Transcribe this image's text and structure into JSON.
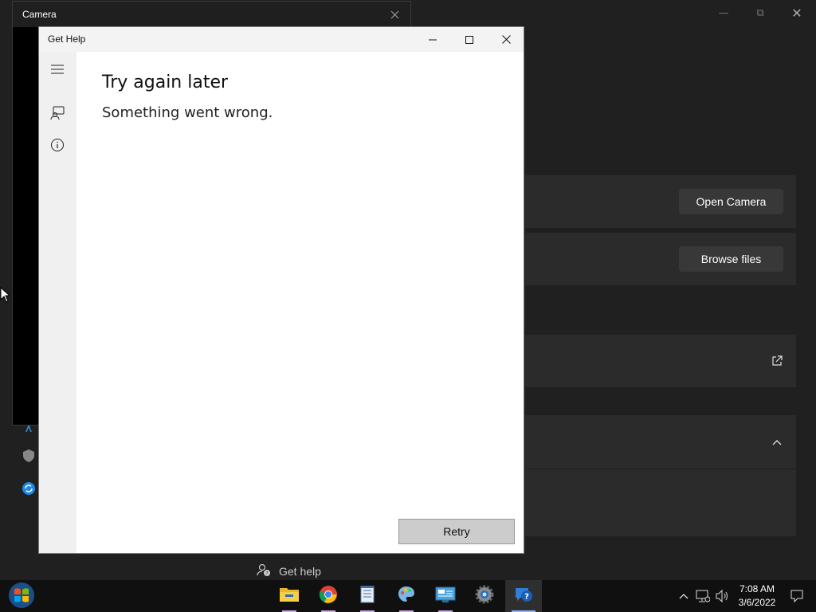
{
  "camera_window": {
    "title": "Camera"
  },
  "settings": {
    "open_camera_label": "Open Camera",
    "browse_files_label": "Browse files"
  },
  "get_help_window": {
    "title": "Get Help",
    "heading": "Try again later",
    "message": "Something went wrong.",
    "retry_label": "Retry"
  },
  "get_help_link": {
    "label": "Get help"
  },
  "taskbar": {
    "apps": [
      "file-explorer-icon",
      "chrome-icon",
      "notepad-icon",
      "paint-icon",
      "control-panel-icon",
      "settings-icon",
      "get-help-icon"
    ],
    "time": "7:08 AM",
    "date": "3/6/2022"
  },
  "colors": {
    "accent": "#0078d4",
    "background": "#202020",
    "card": "#2b2b2b"
  }
}
